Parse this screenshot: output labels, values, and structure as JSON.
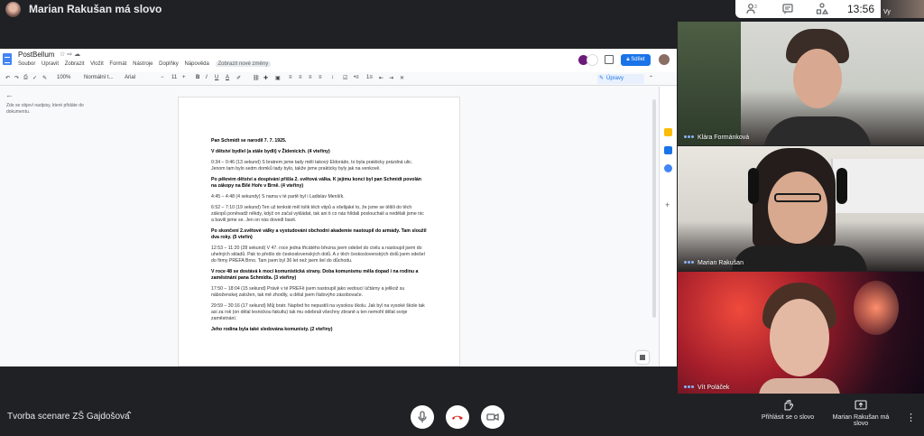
{
  "presenter_banner": "Marian Rakušan má slovo",
  "clock": "13:56",
  "self_label": "Vy",
  "docs": {
    "title": "PostBellum",
    "menu": [
      "Soubor",
      "Upravit",
      "Zobrazit",
      "Vložit",
      "Formát",
      "Nástroje",
      "Doplňky",
      "Nápověda"
    ],
    "last_edit": "Zobrazit nové změny",
    "share_label": "Sdílet",
    "zoom": "100%",
    "style": "Normální t...",
    "font": "Arial",
    "font_size": "11",
    "mode": "Úpravy",
    "outline_hint": "Zde se objeví nadpisy, které přidáte do dokumentu."
  },
  "document": {
    "paragraphs": [
      {
        "bold": true,
        "text": "Pan Schmidt se narodil 7. 7. 1925."
      },
      {
        "bold": true,
        "text": "V dětství bydlel (a stále bydlí) v Židenicích. (4 vteřiny)"
      },
      {
        "bold": false,
        "text": "0:34 – 0:46 (13 sekund) S bratrem jsme tady měli takový Eldorádo, to byla prakticky prázdná ulic. Jenom tam bylo sedm domků tady bylo, takže jsme prakticky byly jak na venkově."
      },
      {
        "bold": true,
        "text": "Po pěkném dětství a dospívání přišla 2. světová válka. K jejímu konci byl pan Schmidt povolán na zákopy na Bílé Hoře v Brně. (4 vteřiny)"
      },
      {
        "bold": false,
        "text": "4:45 – 4:48 (4 sekundy) S nama v té partě byl i Ladislav Menšík."
      },
      {
        "bold": false,
        "text": "6:52 – 7:10 (19 sekund) Ten už tenkrát měl tolik těch vtipů a všelijaké to, že jsme se těšili do těch zákopů poněvadž někdy, když on začal vykládat, tak ani ti co nás hlídali poslouchali a nedělali jsme nic a bavili jsme se. Jen on nás dovedl bavit."
      },
      {
        "bold": true,
        "text": "Po skončení 2.světové války a vystudování obchodní akademie nastoupil do armády. Tam sloužil dva roky. (5 vteřin)"
      },
      {
        "bold": false,
        "text": "12:53 – 11:20 (28 sekund) V 47. roce jedna třicátého března jsem odešel do civilu a nastoupil jsem do uhelných skladů. Pak to přešlo do československých dolů. A z těch československých dolů jsem odešel do firmy PREFA Brno. Tam jsem byl 36 let než jsem šel do důchodu."
      },
      {
        "bold": true,
        "text": "V roce 48 se dostává k moci komunistická strany. Doba komunismu měla dopad i na rodinu a zaměstnání pana Schmidta. (3 vteřiny)"
      },
      {
        "bold": false,
        "text": "17:50 – 18:04 (15 sekund) Právě v té PREFě jsem nastoupil jako vedoucí účtárny a jelikož su náboženskej založen, tak mě zhodily, a dělal jsem řádovýho zásobovače."
      },
      {
        "bold": false,
        "text": "29:59 – 30:16 (17 sekund) Můj bratr. Napřed ho nepustili na vysokou školu. Jak byl na vysoké škole tak asi za rok (on dělal lesnickou fakultu) tak mu odebrali všechny zbraně a ten nemohl dělat svoje zaměstnání."
      },
      {
        "bold": true,
        "text": "Jeho rodina byla také sledována komunisty. (2 vteřiny)"
      }
    ]
  },
  "participants": [
    {
      "name": "Klára Formánková"
    },
    {
      "name": "Marian Rakušan"
    },
    {
      "name": "Vít Poláček"
    }
  ],
  "bottom": {
    "meeting_name": "Tvorba scenare ZŠ Gajdošova",
    "raise_hand": "Přihlásit se o slovo",
    "presenting": "Marian Rakušan má slovo"
  },
  "colors": {
    "meet_bg": "#202124",
    "docs_blue": "#1a73e8",
    "hangup_red": "#d93025",
    "speaking_dots": "#8ab4f8"
  }
}
